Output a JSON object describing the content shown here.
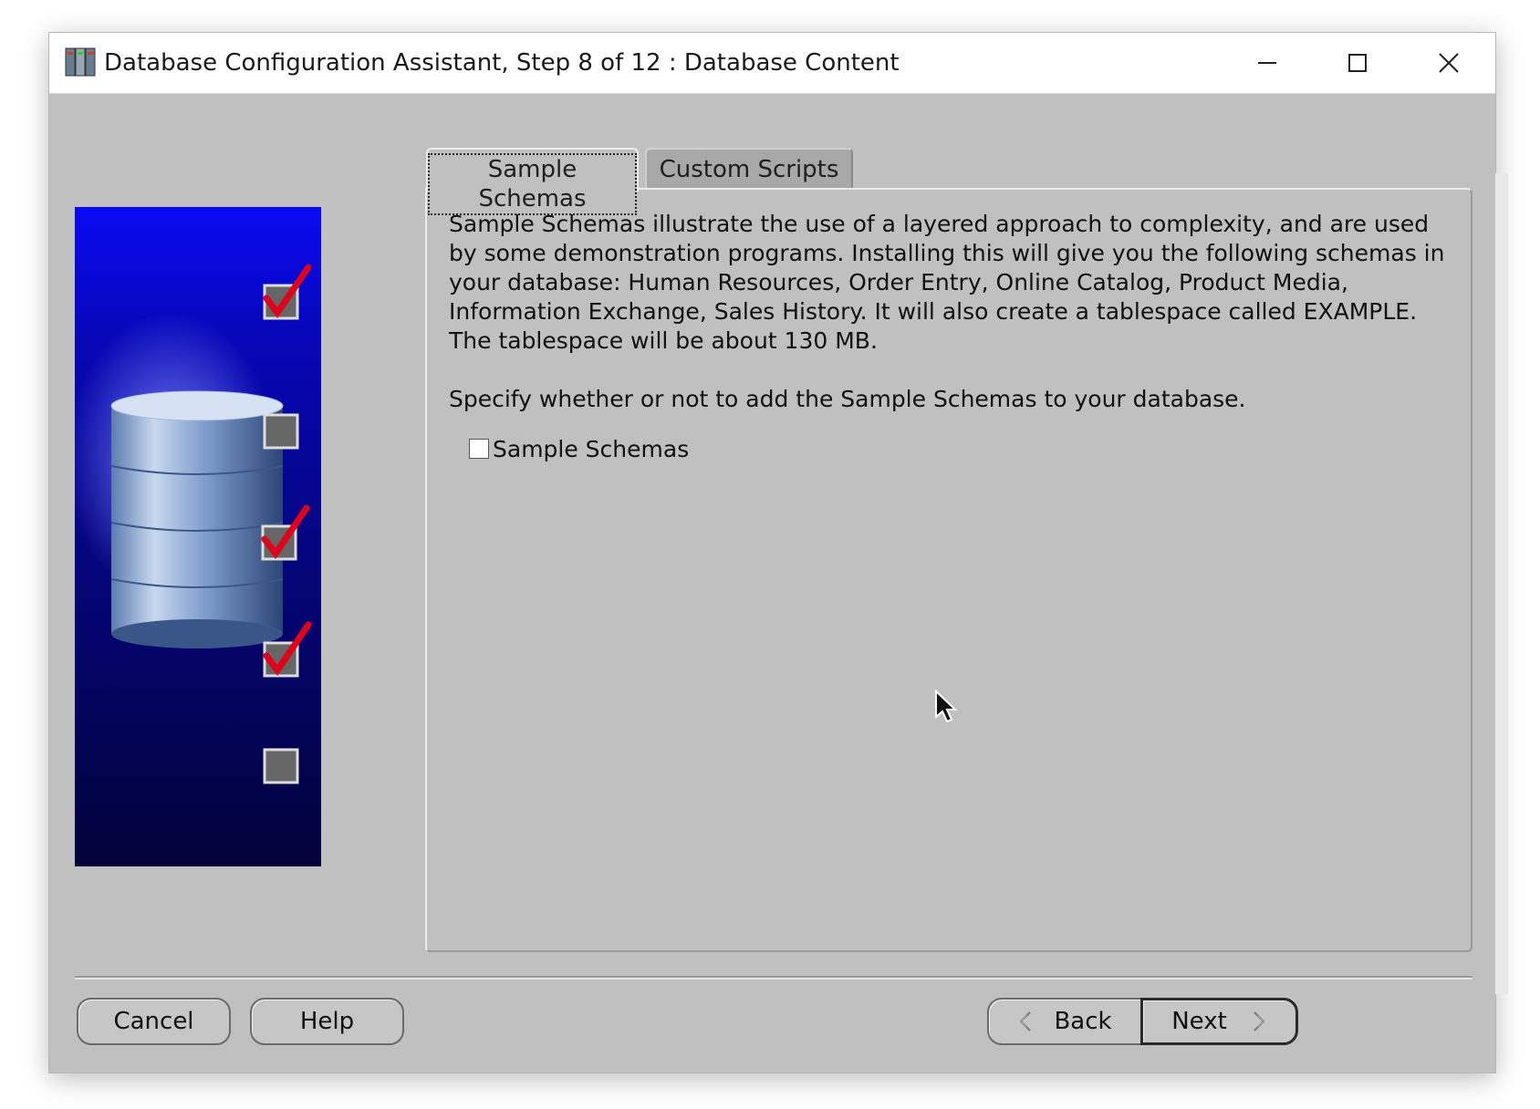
{
  "window": {
    "title": "Database Configuration Assistant, Step 8 of 12 : Database Content"
  },
  "tabs": [
    {
      "label": "Sample Schemas",
      "active": true
    },
    {
      "label": "Custom Scripts",
      "active": false
    }
  ],
  "panel": {
    "description_lines": [
      "Sample Schemas illustrate the use of a layered approach to complexity, and are used",
      "by some demonstration programs. Installing this will give you the following schemas in",
      "your database: Human Resources, Order Entry, Online Catalog, Product Media,",
      "Information Exchange, Sales History. It will also create a tablespace called EXAMPLE.",
      "The tablespace will be about 130 MB."
    ],
    "specify_text": "Specify whether or not to add the Sample Schemas to your database.",
    "checkbox_label": "Sample Schemas",
    "checkbox_checked": false
  },
  "side_image": {
    "steps_checked": [
      true,
      false,
      true,
      true,
      false
    ]
  },
  "buttons": {
    "cancel": "Cancel",
    "help": "Help",
    "back": "Back",
    "next": "Next"
  },
  "icons": {
    "app": "database-app-icon",
    "minimize": "minimize-icon",
    "maximize": "maximize-icon",
    "close": "close-icon"
  }
}
